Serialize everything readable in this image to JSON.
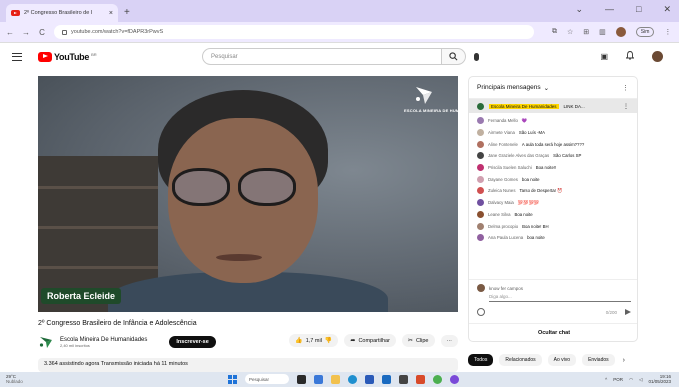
{
  "browser": {
    "tab_title": "2º Congresso Brasileiro de I",
    "tab_close": "×",
    "new_tab": "+",
    "window_controls": [
      "⌄",
      "—",
      "□",
      "✕"
    ],
    "nav": [
      "←",
      "→",
      "C"
    ],
    "url": "youtube.com/watch?v=fDAPR3rPwvS",
    "profile_label": "Sim"
  },
  "header": {
    "logo_text": "YouTube",
    "logo_region": "BR",
    "search_placeholder": "Pesquisar",
    "right_icons": [
      "▣",
      "🔔"
    ]
  },
  "video": {
    "speaker_name": "Roberta Ecleide",
    "brand_text": "ESCOLA MINEIRA DE HUMANIDADES",
    "title": "2º Congresso Brasileiro de Infância e Adolescência",
    "channel_name": "Escola Mineira De Humanidades",
    "channel_subs": "2,40 mil inscritos",
    "subscribe_label": "Inscrever-se",
    "likes": "1,7 mil",
    "share_label": "Compartilhar",
    "clip_label": "Clipe",
    "more_label": "···",
    "description": "3.364 assistindo agora  Transmissão iniciada há 11 minutos"
  },
  "chat": {
    "header": "Principais mensagens",
    "chevron": "⌄",
    "menu": "⋮",
    "pinned_author": "Escola Mineira De Humanidades",
    "pinned_text": "LINK DA...",
    "messages": [
      {
        "author": "Fernanda Mello",
        "text": "💜",
        "color": "#9a7ab0"
      },
      {
        "author": "Airmete Viana",
        "text": "São Luís -MA",
        "color": "#c0b0a0"
      },
      {
        "author": "Aline Fontenele",
        "text": "A aula toda será hoje assim????",
        "color": "#b07060"
      },
      {
        "author": "Jane Graziele Alves das Graças",
        "text": "São Carlos SP",
        "color": "#444444"
      },
      {
        "author": "Priscila Suelen Saluchi",
        "text": "Boa noite!!",
        "color": "#c03070"
      },
      {
        "author": "Dayane Gomes",
        "text": "boa noite",
        "color": "#d0a0b0"
      },
      {
        "author": "Zuleica Nunes",
        "text": "Tarso de Despertar ⏰",
        "color": "#d05050"
      },
      {
        "author": "Dalvacy Maia",
        "text": "💯💯💯💯",
        "color": "#7050a0"
      },
      {
        "author": "Leane Silva",
        "text": "Boa noite",
        "color": "#8a5030"
      },
      {
        "author": "Delma procopio",
        "text": "Boa noite! BH",
        "color": "#a08070"
      },
      {
        "author": "Ana Paula Lucena",
        "text": "boa noite",
        "color": "#9060a0"
      }
    ],
    "input_author": "know fer campos",
    "input_placeholder": "Diga algo...",
    "char_count": "0/200",
    "hide_label": "Ocultar chat"
  },
  "chips": {
    "items": [
      "Todos",
      "Relacionados",
      "Ao vivo",
      "Enviados"
    ],
    "next": "›"
  },
  "taskbar": {
    "weather_temp": "29°C",
    "weather_desc": "Nublado",
    "search_label": "Pesquisar",
    "lang": "POR",
    "time": "19:16",
    "date": "01/05/2023"
  }
}
